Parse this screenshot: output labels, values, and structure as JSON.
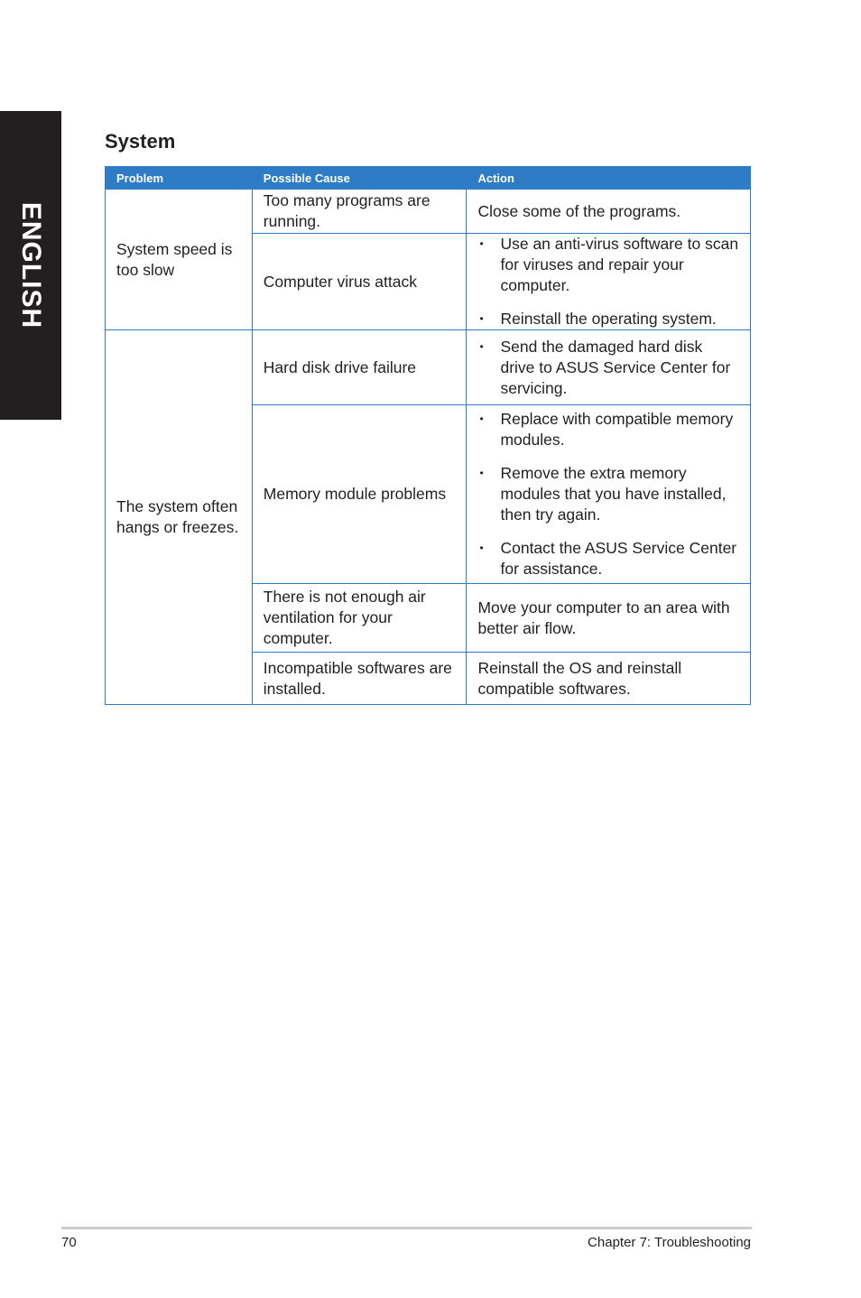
{
  "side_tab": {
    "label": "ENGLISH"
  },
  "section": {
    "title": "System"
  },
  "table": {
    "headers": [
      "Problem",
      "Possible Cause",
      "Action"
    ],
    "groups": [
      {
        "problem": "System speed is too slow",
        "rows": [
          {
            "cause": "Too many programs are running.",
            "action_text": "Close some of the programs."
          },
          {
            "cause": "Computer virus attack",
            "action_bullets": [
              "Use an anti-virus software to scan for viruses and repair your computer.",
              "Reinstall the operating system."
            ]
          }
        ]
      },
      {
        "problem": "The system often hangs or freezes.",
        "rows": [
          {
            "cause": "Hard disk drive failure",
            "action_bullets": [
              "Send the damaged hard disk drive to ASUS Service Center for servicing."
            ]
          },
          {
            "cause": "Memory module problems",
            "action_bullets": [
              "Replace with compatible memory modules.",
              "Remove the extra memory modules that you have installed, then try again.",
              "Contact the ASUS Service Center for assistance."
            ]
          },
          {
            "cause": "There is not enough air ventilation for your computer.",
            "action_text": "Move your computer to an area with better air flow."
          },
          {
            "cause": "Incompatible softwares are installed.",
            "action_text": "Reinstall the OS and reinstall compatible softwares."
          }
        ]
      }
    ]
  },
  "footer": {
    "page_number": "70",
    "chapter": "Chapter 7: Troubleshooting"
  },
  "colors": {
    "header_blue": "#2e7bc6",
    "side_tab": "#231f20"
  }
}
